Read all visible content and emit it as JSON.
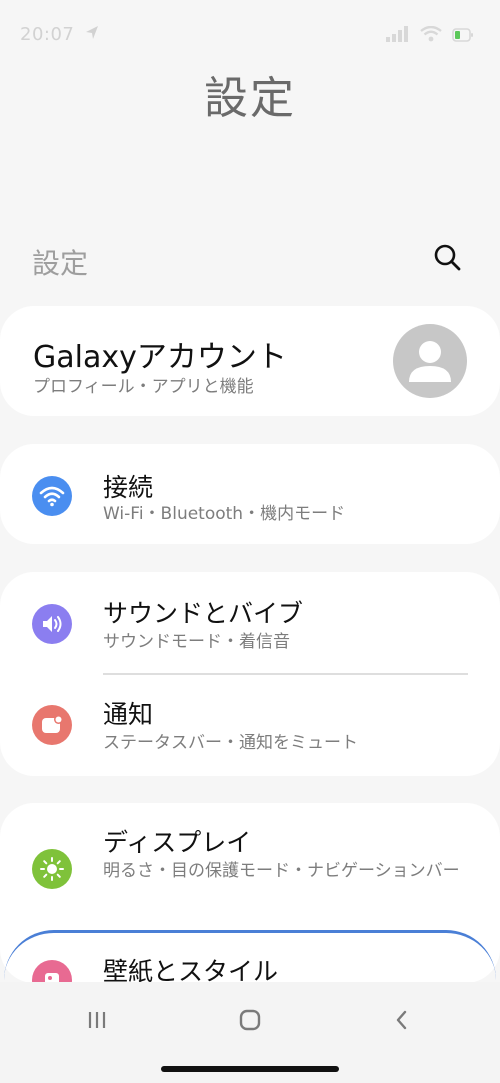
{
  "status_bar": {
    "time": "20:07",
    "icons": [
      "location-arrow-icon",
      "signal-icon",
      "wifi-icon",
      "battery-icon"
    ]
  },
  "page": {
    "large_title": "設定",
    "small_title": "設定",
    "search_icon": "search-icon"
  },
  "account": {
    "title": "Galaxyアカウント",
    "subtitle": "プロフィール・アプリと機能",
    "avatar_icon": "person-icon"
  },
  "settings": [
    {
      "id": "connections",
      "title": "接続",
      "subtitle": "Wi-Fi・Bluetooth・機内モード",
      "icon": "wifi-icon",
      "color": "#4a8ef0"
    },
    {
      "id": "sound",
      "title": "サウンドとバイブ",
      "subtitle": "サウンドモード・着信音",
      "icon": "speaker-icon",
      "color": "#8b7ef0"
    },
    {
      "id": "notifications",
      "title": "通知",
      "subtitle": "ステータスバー・通知をミュート",
      "icon": "notification-icon",
      "color": "#e8776e"
    },
    {
      "id": "display",
      "title": "ディスプレイ",
      "subtitle": "明るさ・目の保護モード・ナビゲーションバー",
      "icon": "sun-icon",
      "color": "#7fc23a"
    },
    {
      "id": "wallpaper",
      "title": "壁紙とスタイル",
      "subtitle": "",
      "icon": "wallpaper-icon",
      "color": "#e86a92"
    }
  ],
  "nav_bar": {
    "recents_icon": "recents-icon",
    "home_icon": "home-icon",
    "back_icon": "back-icon"
  }
}
